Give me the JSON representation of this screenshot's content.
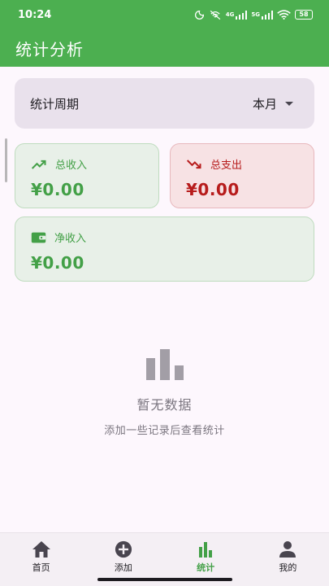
{
  "status_bar": {
    "time": "10:24",
    "network_4g": "4G",
    "network_5g": "5G",
    "battery": "58"
  },
  "app_bar": {
    "title": "统计分析"
  },
  "period": {
    "label": "统计周期",
    "value": "本月"
  },
  "cards": {
    "income": {
      "label": "总收入",
      "value": "¥0.00",
      "color": "#43a047",
      "icon": "trending-up-icon"
    },
    "expense": {
      "label": "总支出",
      "value": "¥0.00",
      "color": "#b71c1c",
      "icon": "trending-down-icon"
    },
    "net": {
      "label": "净收入",
      "value": "¥0.00",
      "color": "#43a047",
      "icon": "wallet-icon"
    }
  },
  "empty_state": {
    "icon": "bar-chart-icon",
    "title": "暂无数据",
    "subtitle": "添加一些记录后查看统计"
  },
  "nav": {
    "items": [
      {
        "label": "首页",
        "icon": "home-icon",
        "active": false
      },
      {
        "label": "添加",
        "icon": "add-circle-icon",
        "active": false
      },
      {
        "label": "统计",
        "icon": "bar-chart-icon",
        "active": true
      },
      {
        "label": "我的",
        "icon": "person-icon",
        "active": false
      }
    ]
  },
  "colors": {
    "primary": "#4caf50",
    "income": "#43a047",
    "expense": "#b71c1c"
  }
}
